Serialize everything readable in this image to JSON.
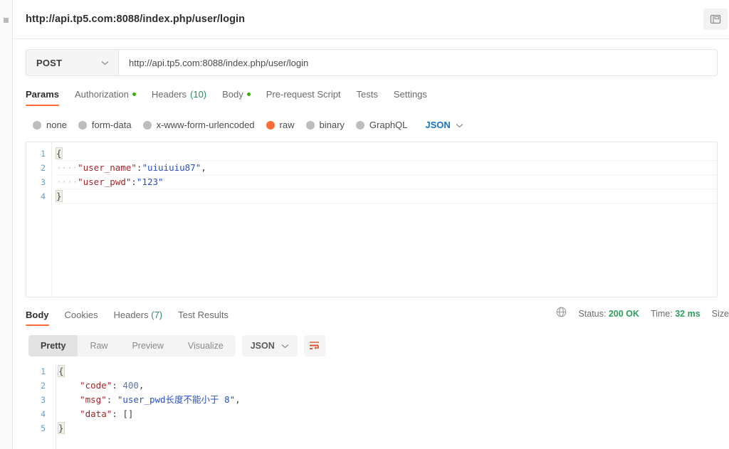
{
  "request": {
    "title": "http://api.tp5.com:8088/index.php/user/login",
    "save_icon": "save-panel-icon",
    "method": "POST",
    "method_chevron": "chevron-down-icon",
    "url": "http://api.tp5.com:8088/index.php/user/login",
    "tabs": [
      {
        "label": "Params",
        "active": false,
        "dot": false,
        "count": ""
      },
      {
        "label": "Authorization",
        "active": false,
        "dot": true,
        "count": ""
      },
      {
        "label": "Headers",
        "active": false,
        "dot": false,
        "count": "(10)"
      },
      {
        "label": "Body",
        "active": true,
        "dot": true,
        "count": ""
      },
      {
        "label": "Pre-request Script",
        "active": false,
        "dot": false,
        "count": ""
      },
      {
        "label": "Tests",
        "active": false,
        "dot": false,
        "count": ""
      },
      {
        "label": "Settings",
        "active": false,
        "dot": false,
        "count": ""
      }
    ],
    "body_types": [
      {
        "label": "none",
        "selected": false
      },
      {
        "label": "form-data",
        "selected": false
      },
      {
        "label": "x-www-form-urlencoded",
        "selected": false
      },
      {
        "label": "raw",
        "selected": true
      },
      {
        "label": "binary",
        "selected": false
      },
      {
        "label": "GraphQL",
        "selected": false
      }
    ],
    "raw_format": "JSON",
    "raw_format_chevron": "chevron-down-icon",
    "body_lines": [
      "1",
      "2",
      "3",
      "4"
    ],
    "body_code": {
      "line1": "{",
      "line2_indent": "····",
      "line2_key": "\"user_name\"",
      "line2_colon": ":",
      "line2_value": "\"uiuiuiu87\"",
      "line2_comma": ",",
      "line3_indent": "····",
      "line3_key": "\"user_pwd\"",
      "line3_colon": ":",
      "line3_value": "\"123\"",
      "line4": "}"
    }
  },
  "response": {
    "tabs": [
      {
        "label": "Body",
        "active": true,
        "count": ""
      },
      {
        "label": "Cookies",
        "active": false,
        "count": ""
      },
      {
        "label": "Headers",
        "active": false,
        "count": "(7)"
      },
      {
        "label": "Test Results",
        "active": false,
        "count": ""
      }
    ],
    "globe_icon": "globe-icon",
    "meta": {
      "status_label": "Status:",
      "status_value": "200 OK",
      "time_label": "Time:",
      "time_value": "32 ms",
      "size_label": "Size"
    },
    "format_views": [
      {
        "label": "Pretty",
        "active": true
      },
      {
        "label": "Raw",
        "active": false
      },
      {
        "label": "Preview",
        "active": false
      },
      {
        "label": "Visualize",
        "active": false
      }
    ],
    "format_type": "JSON",
    "format_chevron": "chevron-down-icon",
    "wrap_icon": "word-wrap-icon",
    "body_lines": [
      "1",
      "2",
      "3",
      "4",
      "5"
    ],
    "body_code": {
      "line1": "{",
      "line2_key": "\"code\"",
      "line2_colon": ": ",
      "line2_value": "400",
      "line2_comma": ",",
      "line3_key": "\"msg\"",
      "line3_colon": ": ",
      "line3_value": "\"user_pwd长度不能小于 8\"",
      "line3_comma": ",",
      "line4_key": "\"data\"",
      "line4_colon": ": ",
      "line4_value": "[]",
      "line5": "}"
    }
  },
  "colors": {
    "accent": "#ff6c37",
    "status_green": "#2f9e5e",
    "json_blue": "#1a73c4",
    "key_red": "#a3262c",
    "string_blue": "#2a4fbf",
    "gutter_blue": "#6a9ec4"
  }
}
